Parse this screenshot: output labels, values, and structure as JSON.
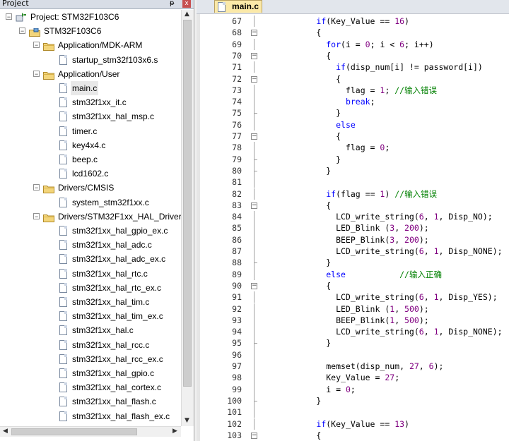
{
  "project_panel": {
    "title": "Project",
    "pin": "ᵽ",
    "close": "x",
    "tree": [
      {
        "label": "Project: STM32F103C6",
        "level": 0,
        "kind": "project",
        "expand": "−"
      },
      {
        "label": "STM32F103C6",
        "level": 1,
        "kind": "target",
        "expand": "−"
      },
      {
        "label": "Application/MDK-ARM",
        "level": 2,
        "kind": "folder",
        "expand": "−"
      },
      {
        "label": "startup_stm32f103x6.s",
        "level": 3,
        "kind": "file"
      },
      {
        "label": "Application/User",
        "level": 2,
        "kind": "folder",
        "expand": "−"
      },
      {
        "label": "main.c",
        "level": 3,
        "kind": "file",
        "selected": true
      },
      {
        "label": "stm32f1xx_it.c",
        "level": 3,
        "kind": "file"
      },
      {
        "label": "stm32f1xx_hal_msp.c",
        "level": 3,
        "kind": "file"
      },
      {
        "label": "timer.c",
        "level": 3,
        "kind": "file"
      },
      {
        "label": "key4x4.c",
        "level": 3,
        "kind": "file"
      },
      {
        "label": "beep.c",
        "level": 3,
        "kind": "file"
      },
      {
        "label": "lcd1602.c",
        "level": 3,
        "kind": "file"
      },
      {
        "label": "Drivers/CMSIS",
        "level": 2,
        "kind": "folder",
        "expand": "−"
      },
      {
        "label": "system_stm32f1xx.c",
        "level": 3,
        "kind": "file"
      },
      {
        "label": "Drivers/STM32F1xx_HAL_Driver",
        "level": 2,
        "kind": "folder",
        "expand": "−"
      },
      {
        "label": "stm32f1xx_hal_gpio_ex.c",
        "level": 3,
        "kind": "file"
      },
      {
        "label": "stm32f1xx_hal_adc.c",
        "level": 3,
        "kind": "file"
      },
      {
        "label": "stm32f1xx_hal_adc_ex.c",
        "level": 3,
        "kind": "file"
      },
      {
        "label": "stm32f1xx_hal_rtc.c",
        "level": 3,
        "kind": "file"
      },
      {
        "label": "stm32f1xx_hal_rtc_ex.c",
        "level": 3,
        "kind": "file"
      },
      {
        "label": "stm32f1xx_hal_tim.c",
        "level": 3,
        "kind": "file"
      },
      {
        "label": "stm32f1xx_hal_tim_ex.c",
        "level": 3,
        "kind": "file"
      },
      {
        "label": "stm32f1xx_hal.c",
        "level": 3,
        "kind": "file"
      },
      {
        "label": "stm32f1xx_hal_rcc.c",
        "level": 3,
        "kind": "file"
      },
      {
        "label": "stm32f1xx_hal_rcc_ex.c",
        "level": 3,
        "kind": "file"
      },
      {
        "label": "stm32f1xx_hal_gpio.c",
        "level": 3,
        "kind": "file"
      },
      {
        "label": "stm32f1xx_hal_cortex.c",
        "level": 3,
        "kind": "file"
      },
      {
        "label": "stm32f1xx_hal_flash.c",
        "level": 3,
        "kind": "file"
      },
      {
        "label": "stm32f1xx_hal_flash_ex.c",
        "level": 3,
        "kind": "file"
      }
    ]
  },
  "editor": {
    "active_tab": "main.c",
    "lines": [
      {
        "n": "67",
        "fold": "",
        "code": [
          [
            "        ",
            ""
          ],
          [
            "if",
            "kw"
          ],
          [
            "(Key_Value == ",
            ""
          ],
          [
            "16",
            "num"
          ],
          [
            ")",
            ""
          ]
        ]
      },
      {
        "n": "68",
        "fold": "open",
        "code": [
          [
            "        {",
            ""
          ]
        ]
      },
      {
        "n": "69",
        "fold": "",
        "code": [
          [
            "          ",
            ""
          ],
          [
            "for",
            "kw"
          ],
          [
            "(i = ",
            ""
          ],
          [
            "0",
            "num"
          ],
          [
            "; i < ",
            ""
          ],
          [
            "6",
            "num"
          ],
          [
            "; i++)",
            ""
          ]
        ]
      },
      {
        "n": "70",
        "fold": "open",
        "code": [
          [
            "          {",
            ""
          ]
        ]
      },
      {
        "n": "71",
        "fold": "",
        "code": [
          [
            "            ",
            ""
          ],
          [
            "if",
            "kw"
          ],
          [
            "(disp_num[i] != password[i])",
            ""
          ]
        ]
      },
      {
        "n": "72",
        "fold": "open",
        "code": [
          [
            "            {",
            ""
          ]
        ]
      },
      {
        "n": "73",
        "fold": "",
        "code": [
          [
            "              flag = ",
            ""
          ],
          [
            "1",
            "num"
          ],
          [
            "; ",
            ""
          ],
          [
            "//输入错误",
            "cm"
          ]
        ]
      },
      {
        "n": "74",
        "fold": "",
        "code": [
          [
            "              ",
            ""
          ],
          [
            "break",
            "kw"
          ],
          [
            ";",
            ""
          ]
        ]
      },
      {
        "n": "75",
        "fold": "end",
        "code": [
          [
            "            }",
            ""
          ]
        ]
      },
      {
        "n": "76",
        "fold": "",
        "code": [
          [
            "            ",
            ""
          ],
          [
            "else",
            "kw"
          ]
        ]
      },
      {
        "n": "77",
        "fold": "open",
        "code": [
          [
            "            {",
            ""
          ]
        ]
      },
      {
        "n": "78",
        "fold": "",
        "code": [
          [
            "              flag = ",
            ""
          ],
          [
            "0",
            "num"
          ],
          [
            ";",
            ""
          ]
        ]
      },
      {
        "n": "79",
        "fold": "end",
        "code": [
          [
            "            }",
            ""
          ]
        ]
      },
      {
        "n": "80",
        "fold": "end",
        "code": [
          [
            "          }",
            ""
          ]
        ]
      },
      {
        "n": "81",
        "fold": "",
        "code": [
          [
            "",
            ""
          ]
        ]
      },
      {
        "n": "82",
        "fold": "",
        "code": [
          [
            "          ",
            ""
          ],
          [
            "if",
            "kw"
          ],
          [
            "(flag == ",
            ""
          ],
          [
            "1",
            "num"
          ],
          [
            ") ",
            ""
          ],
          [
            "//输入错误",
            "cm"
          ]
        ]
      },
      {
        "n": "83",
        "fold": "open",
        "code": [
          [
            "          {",
            ""
          ]
        ]
      },
      {
        "n": "84",
        "fold": "",
        "code": [
          [
            "            LCD_write_string(",
            ""
          ],
          [
            "6",
            "num"
          ],
          [
            ", ",
            ""
          ],
          [
            "1",
            "num"
          ],
          [
            ", Disp_NO);",
            ""
          ]
        ]
      },
      {
        "n": "85",
        "fold": "",
        "code": [
          [
            "            LED_Blink (",
            ""
          ],
          [
            "3",
            "num"
          ],
          [
            ", ",
            ""
          ],
          [
            "200",
            "num"
          ],
          [
            ");",
            ""
          ]
        ]
      },
      {
        "n": "86",
        "fold": "",
        "code": [
          [
            "            BEEP_Blink(",
            ""
          ],
          [
            "3",
            "num"
          ],
          [
            ", ",
            ""
          ],
          [
            "200",
            "num"
          ],
          [
            ");",
            ""
          ]
        ]
      },
      {
        "n": "87",
        "fold": "",
        "code": [
          [
            "            LCD_write_string(",
            ""
          ],
          [
            "6",
            "num"
          ],
          [
            ", ",
            ""
          ],
          [
            "1",
            "num"
          ],
          [
            ", Disp_NONE);",
            ""
          ]
        ]
      },
      {
        "n": "88",
        "fold": "end",
        "code": [
          [
            "          }",
            ""
          ]
        ]
      },
      {
        "n": "89",
        "fold": "",
        "code": [
          [
            "          ",
            ""
          ],
          [
            "else",
            "kw"
          ],
          [
            "           ",
            ""
          ],
          [
            "//输入正确",
            "cm"
          ]
        ]
      },
      {
        "n": "90",
        "fold": "open",
        "code": [
          [
            "          {",
            ""
          ]
        ]
      },
      {
        "n": "91",
        "fold": "",
        "code": [
          [
            "            LCD_write_string(",
            ""
          ],
          [
            "6",
            "num"
          ],
          [
            ", ",
            ""
          ],
          [
            "1",
            "num"
          ],
          [
            ", Disp_YES);",
            ""
          ]
        ]
      },
      {
        "n": "92",
        "fold": "",
        "code": [
          [
            "            LED_Blink (",
            ""
          ],
          [
            "1",
            "num"
          ],
          [
            ", ",
            ""
          ],
          [
            "500",
            "num"
          ],
          [
            ");",
            ""
          ]
        ]
      },
      {
        "n": "93",
        "fold": "",
        "code": [
          [
            "            BEEP_Blink(",
            ""
          ],
          [
            "1",
            "num"
          ],
          [
            ", ",
            ""
          ],
          [
            "500",
            "num"
          ],
          [
            ");",
            ""
          ]
        ]
      },
      {
        "n": "94",
        "fold": "",
        "code": [
          [
            "            LCD_write_string(",
            ""
          ],
          [
            "6",
            "num"
          ],
          [
            ", ",
            ""
          ],
          [
            "1",
            "num"
          ],
          [
            ", Disp_NONE);",
            ""
          ]
        ]
      },
      {
        "n": "95",
        "fold": "end",
        "code": [
          [
            "          }",
            ""
          ]
        ]
      },
      {
        "n": "96",
        "fold": "",
        "code": [
          [
            "",
            ""
          ]
        ]
      },
      {
        "n": "97",
        "fold": "",
        "code": [
          [
            "          memset(disp_num, ",
            ""
          ],
          [
            "27",
            "num"
          ],
          [
            ", ",
            ""
          ],
          [
            "6",
            "num"
          ],
          [
            ");",
            ""
          ]
        ]
      },
      {
        "n": "98",
        "fold": "",
        "code": [
          [
            "          Key_Value = ",
            ""
          ],
          [
            "27",
            "num"
          ],
          [
            ";",
            ""
          ]
        ]
      },
      {
        "n": "99",
        "fold": "",
        "code": [
          [
            "          i = ",
            ""
          ],
          [
            "0",
            "num"
          ],
          [
            ";",
            ""
          ]
        ]
      },
      {
        "n": "100",
        "fold": "end",
        "code": [
          [
            "        }",
            ""
          ]
        ]
      },
      {
        "n": "101",
        "fold": "",
        "code": [
          [
            "",
            ""
          ]
        ]
      },
      {
        "n": "102",
        "fold": "",
        "code": [
          [
            "        ",
            ""
          ],
          [
            "if",
            "kw"
          ],
          [
            "(Key_Value == ",
            ""
          ],
          [
            "13",
            "num"
          ],
          [
            ")",
            ""
          ]
        ]
      },
      {
        "n": "103",
        "fold": "open",
        "code": [
          [
            "        {",
            ""
          ]
        ]
      }
    ]
  }
}
